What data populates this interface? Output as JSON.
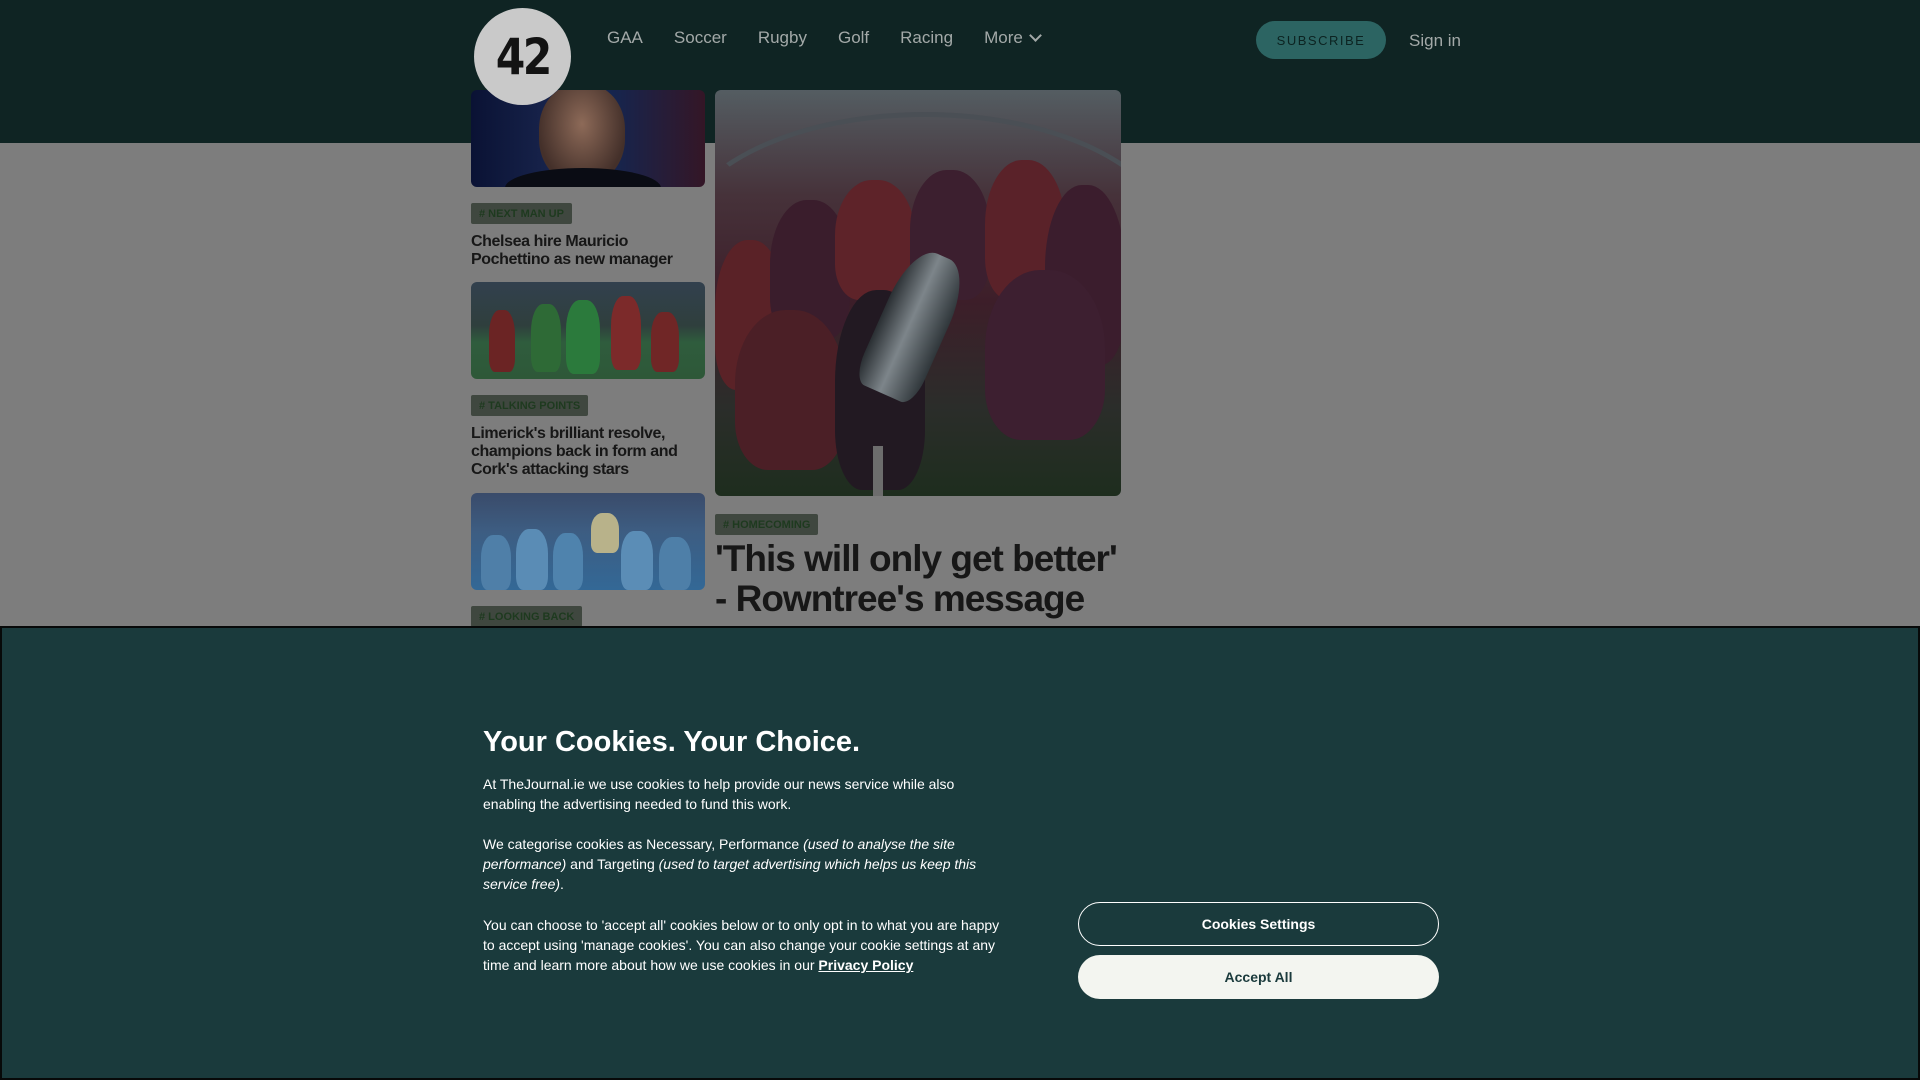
{
  "header": {
    "logo_text": "42",
    "nav": [
      {
        "label": "GAA"
      },
      {
        "label": "Soccer"
      },
      {
        "label": "Rugby"
      },
      {
        "label": "Golf"
      },
      {
        "label": "Racing"
      },
      {
        "label": "More"
      }
    ],
    "subscribe_label": "SUBSCRIBE",
    "signin_label": "Sign in"
  },
  "articles": [
    {
      "tag": "# NEXT MAN UP",
      "title": "Chelsea hire Mauricio Pochettino as new manager"
    },
    {
      "tag": "# TALKING POINTS",
      "title": "Limerick's brilliant resolve, champions back in form and Cork's attacking stars"
    },
    {
      "tag": "# LOOKING BACK",
      "title": ""
    }
  ],
  "hero": {
    "tag": "# HOMECOMING",
    "title": "'This will only get better' - Rowntree's message to"
  },
  "cookie": {
    "title": "Your Cookies. Your Choice.",
    "p1": "At TheJournal.ie we use cookies to help provide our news service while also enabling the advertising needed to fund this work.",
    "p2_a": "We categorise cookies as Necessary, Performance ",
    "p2_b": "(used to analyse the site performance)",
    "p2_c": " and Targeting ",
    "p2_d": "(used to target advertising which helps us keep this service free)",
    "p2_e": ".",
    "p3": "You can choose to 'accept all' cookies below or to only opt in to what you are happy to accept using 'manage cookies'. You can also change your cookie settings at any time and learn more about how we use cookies in our ",
    "privacy_link": "Privacy Policy",
    "settings_label": "Cookies Settings",
    "accept_label": "Accept All"
  }
}
